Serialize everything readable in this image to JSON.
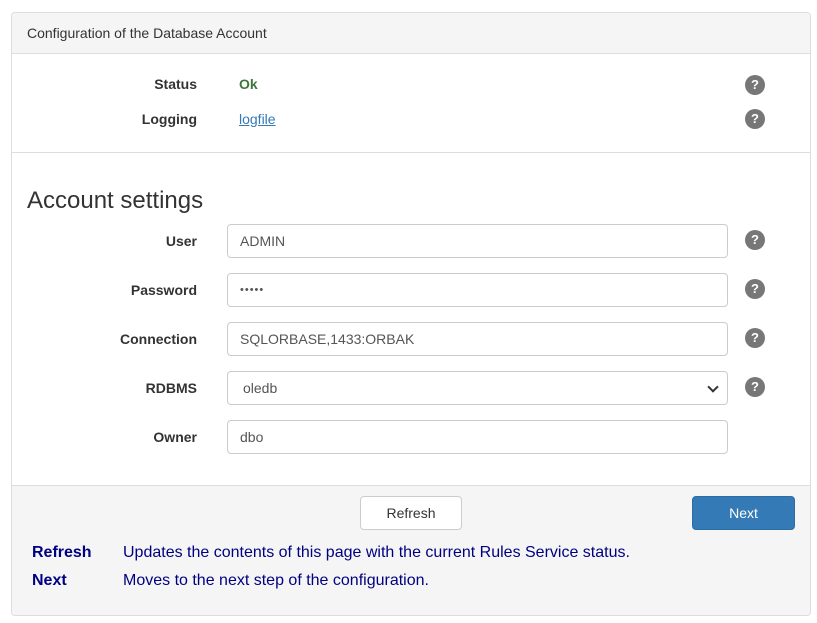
{
  "panel": {
    "title": "Configuration of the Database Account"
  },
  "status": {
    "status_label": "Status",
    "status_value": "Ok",
    "logging_label": "Logging",
    "logging_value": "logfile",
    "help_glyph": "?"
  },
  "settings": {
    "heading": "Account settings",
    "user_label": "User",
    "user_value": "ADMIN",
    "password_label": "Password",
    "password_value": "•••••",
    "connection_label": "Connection",
    "connection_value": "SQLORBASE,1433:ORBAK",
    "rdbms_label": "RDBMS",
    "rdbms_value": "oledb",
    "owner_label": "Owner",
    "owner_value": "dbo"
  },
  "footer": {
    "refresh_button": "Refresh",
    "next_button": "Next",
    "help": [
      {
        "term": "Refresh",
        "desc": "Updates the contents of this page with the current Rules Service status."
      },
      {
        "term": "Next",
        "desc": "Moves to the next step of the configuration."
      }
    ]
  },
  "colors": {
    "primary": "#337ab7",
    "ok": "#3c763d",
    "help_text": "#000080",
    "help_icon": "#777777"
  },
  "icons": [
    "help-icon",
    "chevron-down-icon"
  ]
}
